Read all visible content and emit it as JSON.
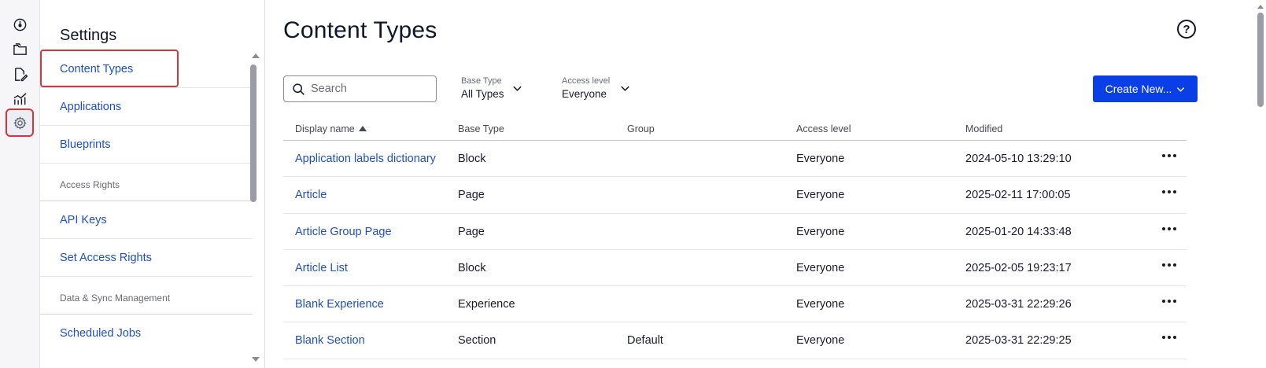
{
  "rail": {
    "icons": [
      "dashboard-icon",
      "folders-icon",
      "edit-document-icon",
      "analytics-icon",
      "settings-icon"
    ],
    "selected": "settings-icon"
  },
  "panel": {
    "title": "Settings",
    "items": [
      {
        "label": "Content Types"
      },
      {
        "label": "Applications"
      },
      {
        "label": "Blueprints"
      }
    ],
    "access_rights_heading": "Access Rights",
    "access_items": [
      {
        "label": "API Keys"
      },
      {
        "label": "Set Access Rights"
      }
    ],
    "data_sync_heading": "Data & Sync Management",
    "data_items": [
      {
        "label": "Scheduled Jobs"
      }
    ]
  },
  "main": {
    "title": "Content Types",
    "help_symbol": "?",
    "search": {
      "placeholder": "Search",
      "value": ""
    },
    "filters": {
      "base_type": {
        "label": "Base Type",
        "value": "All Types"
      },
      "access_level": {
        "label": "Access level",
        "value": "Everyone"
      }
    },
    "create_label": "Create New...",
    "table": {
      "columns": [
        "Display name",
        "Base Type",
        "Group",
        "Access level",
        "Modified"
      ],
      "sorted_by": "Display name",
      "sort_direction": "ascending",
      "rows": [
        {
          "name": "Application labels dictionary",
          "base_type": "Block",
          "group": "",
          "access": "Everyone",
          "modified": "2024-05-10 13:29:10"
        },
        {
          "name": "Article",
          "base_type": "Page",
          "group": "",
          "access": "Everyone",
          "modified": "2025-02-11 17:00:05"
        },
        {
          "name": "Article Group Page",
          "base_type": "Page",
          "group": "",
          "access": "Everyone",
          "modified": "2025-01-20 14:33:48"
        },
        {
          "name": "Article List",
          "base_type": "Block",
          "group": "",
          "access": "Everyone",
          "modified": "2025-02-05 19:23:17"
        },
        {
          "name": "Blank Experience",
          "base_type": "Experience",
          "group": "",
          "access": "Everyone",
          "modified": "2025-03-31 22:29:26"
        },
        {
          "name": "Blank Section",
          "base_type": "Section",
          "group": "Default",
          "access": "Everyone",
          "modified": "2025-03-31 22:29:25"
        }
      ]
    }
  },
  "colors": {
    "accent": "#0b3fe6",
    "link": "#1f4fc4",
    "highlight": "#d9343b"
  }
}
